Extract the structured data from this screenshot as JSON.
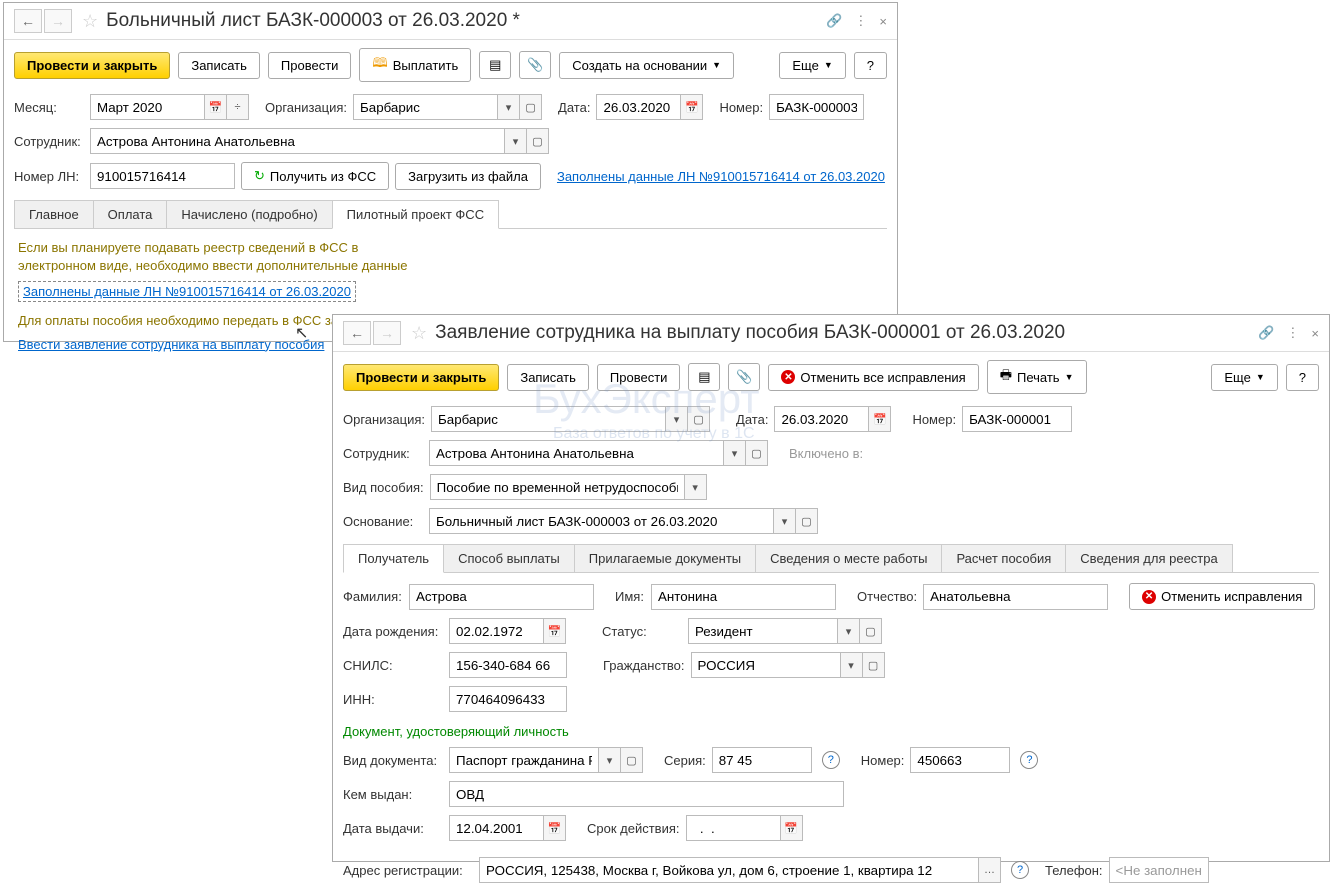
{
  "win1": {
    "title": "Больничный лист БАЗК-000003 от 26.03.2020 *",
    "btn_primary": "Провести и закрыть",
    "btn_save": "Записать",
    "btn_post": "Провести",
    "btn_pay": "Выплатить",
    "btn_create": "Создать на основании",
    "btn_more": "Еще",
    "lbl_month": "Месяц:",
    "val_month": "Март 2020",
    "lbl_org": "Организация:",
    "val_org": "Барбарис",
    "lbl_date": "Дата:",
    "val_date": "26.03.2020",
    "lbl_num": "Номер:",
    "val_num": "БАЗК-000003",
    "lbl_emp": "Сотрудник:",
    "val_emp": "Астрова Антонина Анатольевна",
    "lbl_ln": "Номер ЛН:",
    "val_ln": "910015716414",
    "btn_fss": "Получить из ФСС",
    "btn_load": "Загрузить из файла",
    "link_ln": "Заполнены данные ЛН №910015716414 от 26.03.2020",
    "tabs": [
      "Главное",
      "Оплата",
      "Начислено (подробно)",
      "Пилотный проект ФСС"
    ],
    "info1": "Если вы планируете подавать реестр сведений в ФСС в",
    "info2": "электронном виде, необходимо ввести дополнительные данные",
    "link_ln2": "Заполнены данные ЛН №910015716414 от 26.03.2020",
    "info3": "Для оплаты пособия необходимо передать в ФСС заявление работника на выплату пособия",
    "link_app": "Ввести заявление сотрудника на выплату пособия"
  },
  "win2": {
    "title": "Заявление сотрудника на выплату пособия БАЗК-000001 от 26.03.2020",
    "btn_primary": "Провести и закрыть",
    "btn_save": "Записать",
    "btn_post": "Провести",
    "btn_cancel": "Отменить все исправления",
    "btn_print": "Печать",
    "btn_more": "Еще",
    "lbl_org": "Организация:",
    "val_org": "Барбарис",
    "lbl_date": "Дата:",
    "val_date": "26.03.2020",
    "lbl_num": "Номер:",
    "val_num": "БАЗК-000001",
    "lbl_emp": "Сотрудник:",
    "val_emp": "Астрова Антонина Анатольевна",
    "lbl_incl": "Включено в:",
    "lbl_type": "Вид пособия:",
    "val_type": "Пособие по временной нетрудоспособности",
    "lbl_basis": "Основание:",
    "val_basis": "Больничный лист БАЗК-000003 от 26.03.2020",
    "tabs": [
      "Получатель",
      "Способ выплаты",
      "Прилагаемые документы",
      "Сведения о месте работы",
      "Расчет пособия",
      "Сведения для реестра"
    ],
    "lbl_lname": "Фамилия:",
    "val_lname": "Астрова",
    "lbl_fname": "Имя:",
    "val_fname": "Антонина",
    "lbl_mname": "Отчество:",
    "val_mname": "Анатольевна",
    "btn_cancel2": "Отменить исправления",
    "lbl_bdate": "Дата рождения:",
    "val_bdate": "02.02.1972",
    "lbl_status": "Статус:",
    "val_status": "Резидент",
    "lbl_snils": "СНИЛС:",
    "val_snils": "156-340-684 66",
    "lbl_citizen": "Гражданство:",
    "val_citizen": "РОССИЯ",
    "lbl_inn": "ИНН:",
    "val_inn": "770464096433",
    "hdr_doc": "Документ, удостоверяющий личность",
    "lbl_doctype": "Вид документа:",
    "val_doctype": "Паспорт гражданина Росс",
    "lbl_series": "Серия:",
    "val_series": "87 45",
    "lbl_docnum": "Номер:",
    "val_docnum": "450663",
    "lbl_issued": "Кем выдан:",
    "val_issued": "ОВД",
    "lbl_issdate": "Дата выдачи:",
    "val_issdate": "12.04.2001",
    "lbl_valid": "Срок действия:",
    "val_valid": "  .  .    ",
    "lbl_addr": "Адрес регистрации:",
    "val_addr": "РОССИЯ, 125438, Москва г, Войкова ул, дом 6, строение 1, квартира 12",
    "lbl_phone": "Телефон:",
    "val_phone": "<Не заполнен>",
    "watermark": "БухЭксперт",
    "watermark2": "База ответов по учету в 1С"
  }
}
